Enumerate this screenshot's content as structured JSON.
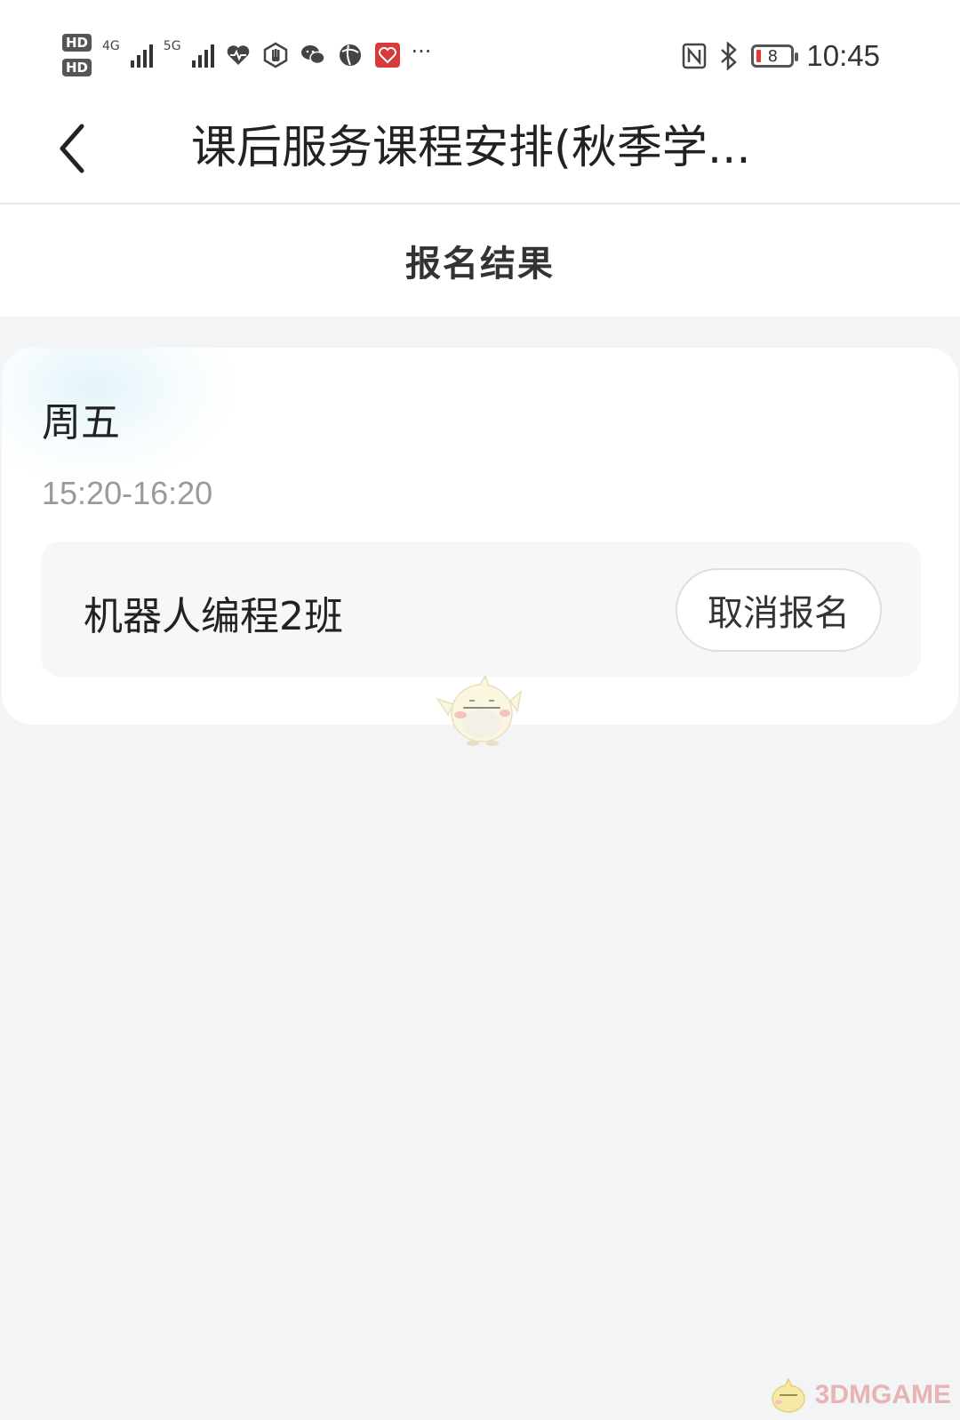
{
  "status_bar": {
    "hd1": "HD",
    "hd2": "HD",
    "network_1": "4G",
    "network_2": "5G",
    "battery_level": "8",
    "time": "10:45",
    "more": "···",
    "icons": [
      "signal-icon",
      "heart-rate-icon",
      "hand-icon",
      "wechat-icon",
      "browser-icon",
      "pinduoduo-icon",
      "nfc-icon",
      "bluetooth-icon",
      "battery-icon"
    ]
  },
  "header": {
    "title": "课后服务课程安排(秋季学..."
  },
  "section": {
    "title": "报名结果"
  },
  "schedule": {
    "day": "周五",
    "time_range": "15:20-16:20",
    "courses": [
      {
        "name": "机器人编程2班",
        "action_label": "取消报名"
      }
    ]
  },
  "watermark": {
    "text": "3DMGAME"
  },
  "colors": {
    "background": "#f3f4f6",
    "card": "#ffffff",
    "course_row": "#f7f7f8",
    "muted_text": "#9a9a9a",
    "battery_low": "#e53935",
    "watermark": "#e8b3b3"
  }
}
